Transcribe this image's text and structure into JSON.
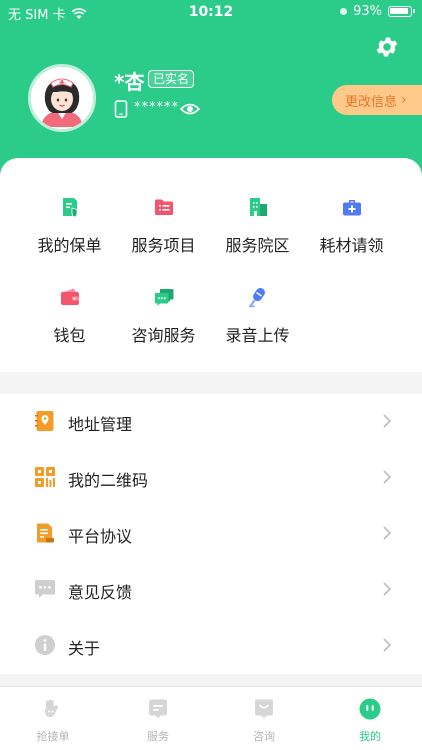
{
  "status_bar": {
    "carrier": "无 SIM 卡",
    "time": "10:12",
    "battery": "93%"
  },
  "profile": {
    "name": "*杏",
    "verified_badge": "已实名",
    "phone_masked": "******",
    "edit_button": "更改信息"
  },
  "services": [
    {
      "label": "我的保单",
      "icon": "policy-icon",
      "color": "#2bcb8a"
    },
    {
      "label": "服务项目",
      "icon": "folder-list-icon",
      "color": "#f2556c"
    },
    {
      "label": "服务院区",
      "icon": "building-icon",
      "color": "#2bcb8a"
    },
    {
      "label": "耗材请领",
      "icon": "medical-kit-icon",
      "color": "#4f7cf6"
    },
    {
      "label": "钱包",
      "icon": "wallet-icon",
      "color": "#f2556c"
    },
    {
      "label": "咨询服务",
      "icon": "chat-icon",
      "color": "#2bcb8a"
    },
    {
      "label": "录音上传",
      "icon": "microphone-icon",
      "color": "#4f7cf6"
    }
  ],
  "menu": [
    {
      "label": "地址管理",
      "icon": "address-book-icon"
    },
    {
      "label": "我的二维码",
      "icon": "qr-code-icon"
    },
    {
      "label": "平台协议",
      "icon": "agreement-icon"
    },
    {
      "label": "意见反馈",
      "icon": "feedback-icon"
    },
    {
      "label": "关于",
      "icon": "info-icon"
    }
  ],
  "tabs": [
    {
      "label": "抢接单",
      "icon": "grab-order-icon",
      "active": false
    },
    {
      "label": "服务",
      "icon": "service-icon",
      "active": false
    },
    {
      "label": "咨询",
      "icon": "consult-icon",
      "active": false
    },
    {
      "label": "我的",
      "icon": "my-icon",
      "active": true
    }
  ],
  "colors": {
    "primary": "#2bcb8a",
    "accent_orange": "#f39c27",
    "edit_button_bg": "#ffc98a",
    "edit_button_text": "#e8762c"
  }
}
